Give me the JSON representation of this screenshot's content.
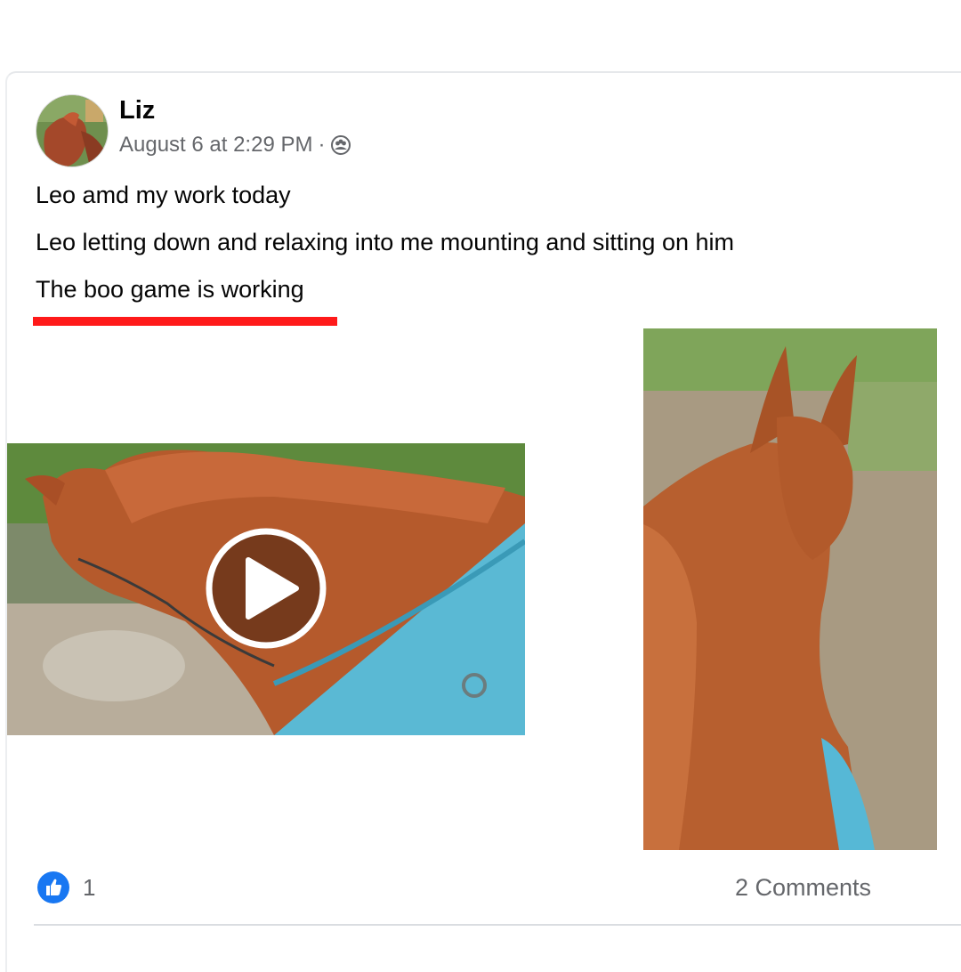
{
  "post": {
    "author": "Liz",
    "timestamp": "August 6 at 2:29 PM",
    "separator": "·",
    "audience_icon": "friends-icon",
    "lines": [
      "Leo amd my work today",
      "Leo letting down and relaxing into me mounting and sitting on him",
      "The boo game is working"
    ],
    "highlight_color": "#ff1a1a",
    "media": [
      {
        "type": "video",
        "icon": "play-icon"
      },
      {
        "type": "photo"
      }
    ]
  },
  "footer": {
    "reaction_icon": "like-icon",
    "like_count": "1",
    "comments_label": "2 Comments"
  },
  "colors": {
    "primary_text": "#050505",
    "secondary_text": "#65676b",
    "like_blue": "#1877f2",
    "divider": "#dadde1"
  }
}
